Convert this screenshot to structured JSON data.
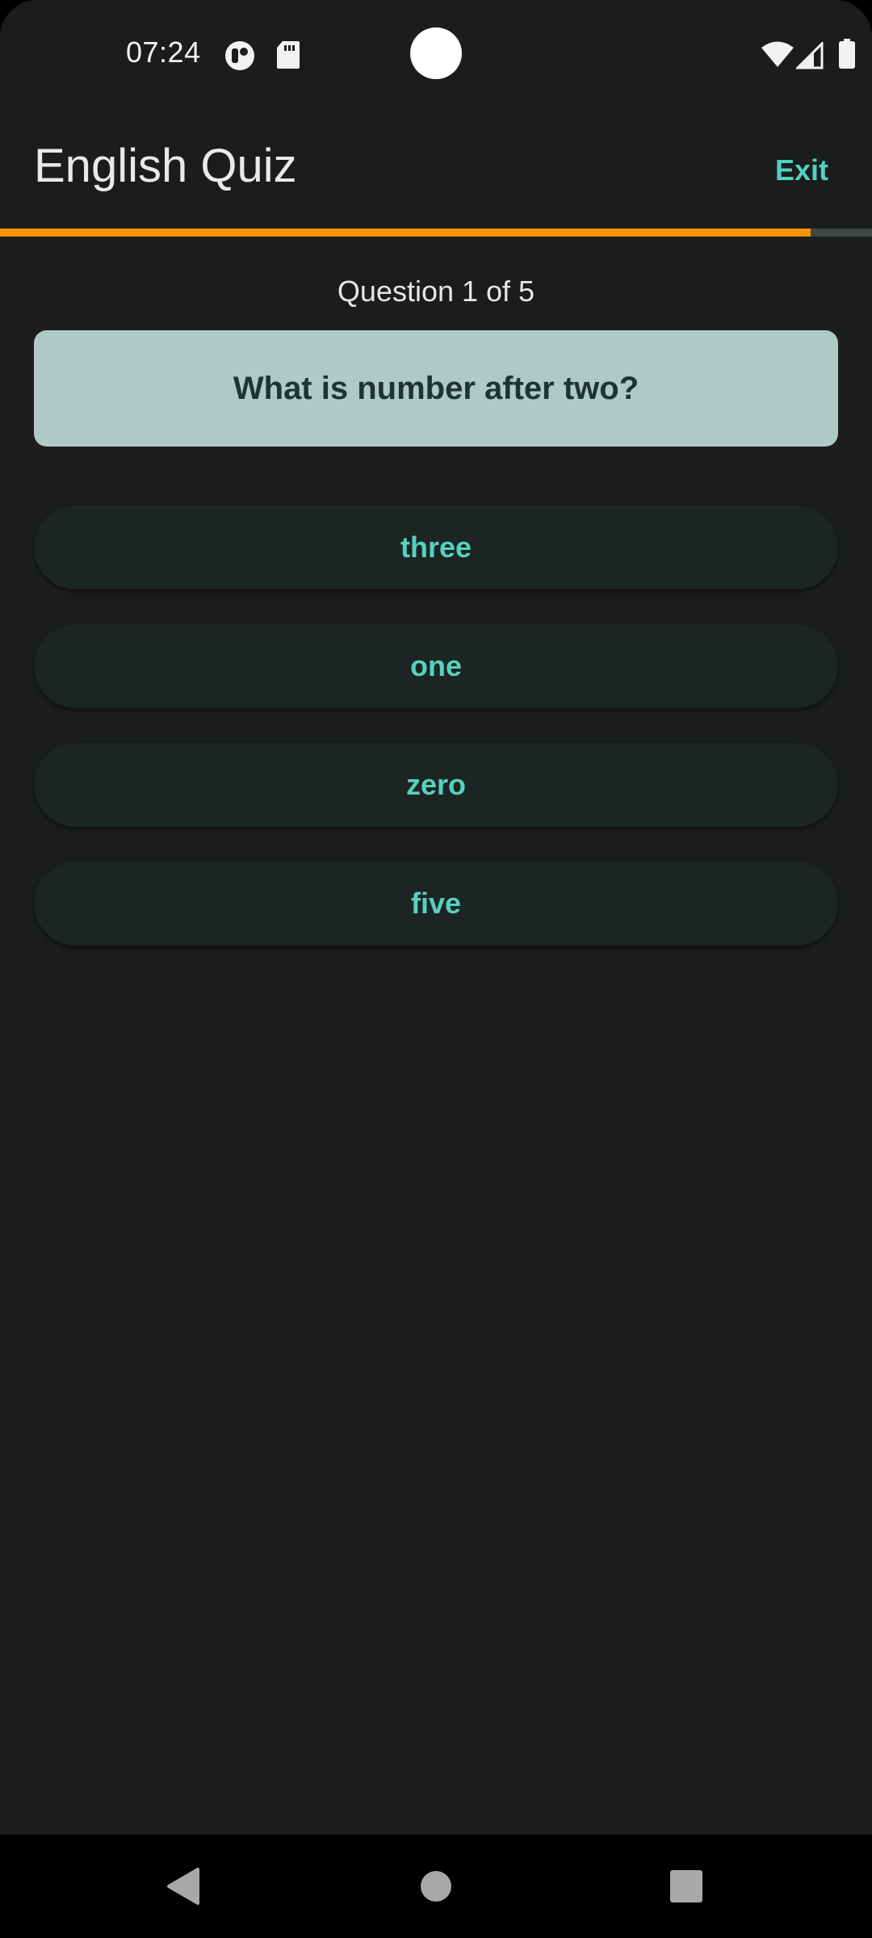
{
  "status_bar": {
    "time": "07:24",
    "left_icons": [
      "record-icon",
      "sd-card-icon"
    ],
    "right_icons": [
      "wifi-icon",
      "cellular-signal-icon",
      "battery-icon"
    ]
  },
  "app_bar": {
    "title": "English Quiz",
    "exit_label": "Exit"
  },
  "progress": {
    "fraction": 0.93,
    "fill_color": "#f59208",
    "track_color": "#3f4646"
  },
  "quiz": {
    "counter": "Question 1 of 5",
    "question": "What is number after two?",
    "answers": [
      {
        "label": "three"
      },
      {
        "label": "one"
      },
      {
        "label": "zero"
      },
      {
        "label": "five"
      }
    ]
  },
  "nav_bar": {
    "icons": [
      "back-icon",
      "home-icon",
      "recents-icon"
    ]
  },
  "colors": {
    "background": "#1b1c1c",
    "accent": "#4fd1c0",
    "question_card": "#afcac5"
  }
}
